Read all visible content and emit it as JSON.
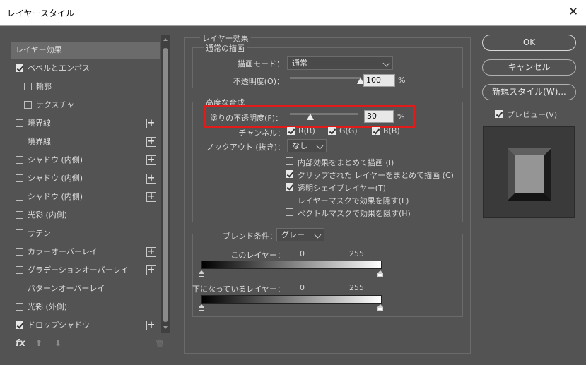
{
  "window": {
    "title": "レイヤースタイル",
    "close": "✕"
  },
  "sidebar": {
    "items": [
      {
        "label": "レイヤー効果",
        "checkbox": false,
        "checked": false,
        "plus": false,
        "selected": true
      },
      {
        "label": "ベベルとエンボス",
        "checkbox": true,
        "checked": true,
        "plus": false
      },
      {
        "label": "輪郭",
        "checkbox": true,
        "checked": false,
        "plus": false,
        "indent": true
      },
      {
        "label": "テクスチャ",
        "checkbox": true,
        "checked": false,
        "plus": false,
        "indent": true
      },
      {
        "label": "境界線",
        "checkbox": true,
        "checked": false,
        "plus": true
      },
      {
        "label": "境界線",
        "checkbox": true,
        "checked": false,
        "plus": true
      },
      {
        "label": "シャドウ (内側)",
        "checkbox": true,
        "checked": false,
        "plus": true
      },
      {
        "label": "シャドウ (内側)",
        "checkbox": true,
        "checked": false,
        "plus": true
      },
      {
        "label": "シャドウ (内側)",
        "checkbox": true,
        "checked": false,
        "plus": true
      },
      {
        "label": "光彩 (内側)",
        "checkbox": true,
        "checked": false,
        "plus": false
      },
      {
        "label": "サテン",
        "checkbox": true,
        "checked": false,
        "plus": false
      },
      {
        "label": "カラーオーバーレイ",
        "checkbox": true,
        "checked": false,
        "plus": true
      },
      {
        "label": "グラデーションオーバーレイ",
        "checkbox": true,
        "checked": false,
        "plus": true
      },
      {
        "label": "パターンオーバーレイ",
        "checkbox": true,
        "checked": false,
        "plus": false
      },
      {
        "label": "光彩 (外側)",
        "checkbox": true,
        "checked": false,
        "plus": false
      },
      {
        "label": "ドロップシャドウ",
        "checkbox": true,
        "checked": true,
        "plus": true
      }
    ],
    "footer": {
      "fx": "fx",
      "up": "⬆",
      "down": "⬇",
      "trash": "🗑"
    }
  },
  "layer_effects": {
    "section_title": "レイヤー効果",
    "normal_blend": {
      "title": "通常の描画",
      "blend_mode_label": "描画モード：",
      "blend_mode_value": "通常",
      "opacity_label": "不透明度(O)：",
      "opacity_value": "100",
      "opacity_unit": "%",
      "opacity_level": 100
    },
    "advanced_blend": {
      "title": "高度な合成",
      "fill_opacity_label": "塗りの不透明度(F)：",
      "fill_opacity_value": "30",
      "fill_opacity_unit": "%",
      "fill_opacity_level": 30,
      "channels_label": "チャンネル：",
      "channels": [
        {
          "label": "R(R)",
          "checked": true
        },
        {
          "label": "G(G)",
          "checked": true
        },
        {
          "label": "B(B)",
          "checked": true
        }
      ],
      "knockout_label": "ノックアウト (抜き)：",
      "knockout_value": "なし",
      "options": [
        {
          "label": "内部効果をまとめて描画 (I)",
          "checked": false
        },
        {
          "label": "クリップされた レイヤーをまとめて描画 (C)",
          "checked": true
        },
        {
          "label": "透明シェイプレイヤー(T)",
          "checked": true
        },
        {
          "label": "レイヤーマスクで効果を隠す(L)",
          "checked": false
        },
        {
          "label": "ベクトルマスクで効果を隠す(H)",
          "checked": false
        }
      ]
    },
    "blend_if": {
      "label": "ブレンド条件：",
      "value": "グレー",
      "this_layer_label": "このレイヤー：",
      "this_layer_min": "0",
      "this_layer_max": "255",
      "underlying_label": "下になっているレイヤー：",
      "underlying_min": "0",
      "underlying_max": "255"
    }
  },
  "buttons": {
    "ok": "OK",
    "cancel": "キャンセル",
    "new_style": "新規スタイル(W)...",
    "preview_label": "プレビュー(V)",
    "preview_checked": true
  },
  "colors": {
    "highlight": "#e11a1a",
    "panel": "#535353"
  }
}
